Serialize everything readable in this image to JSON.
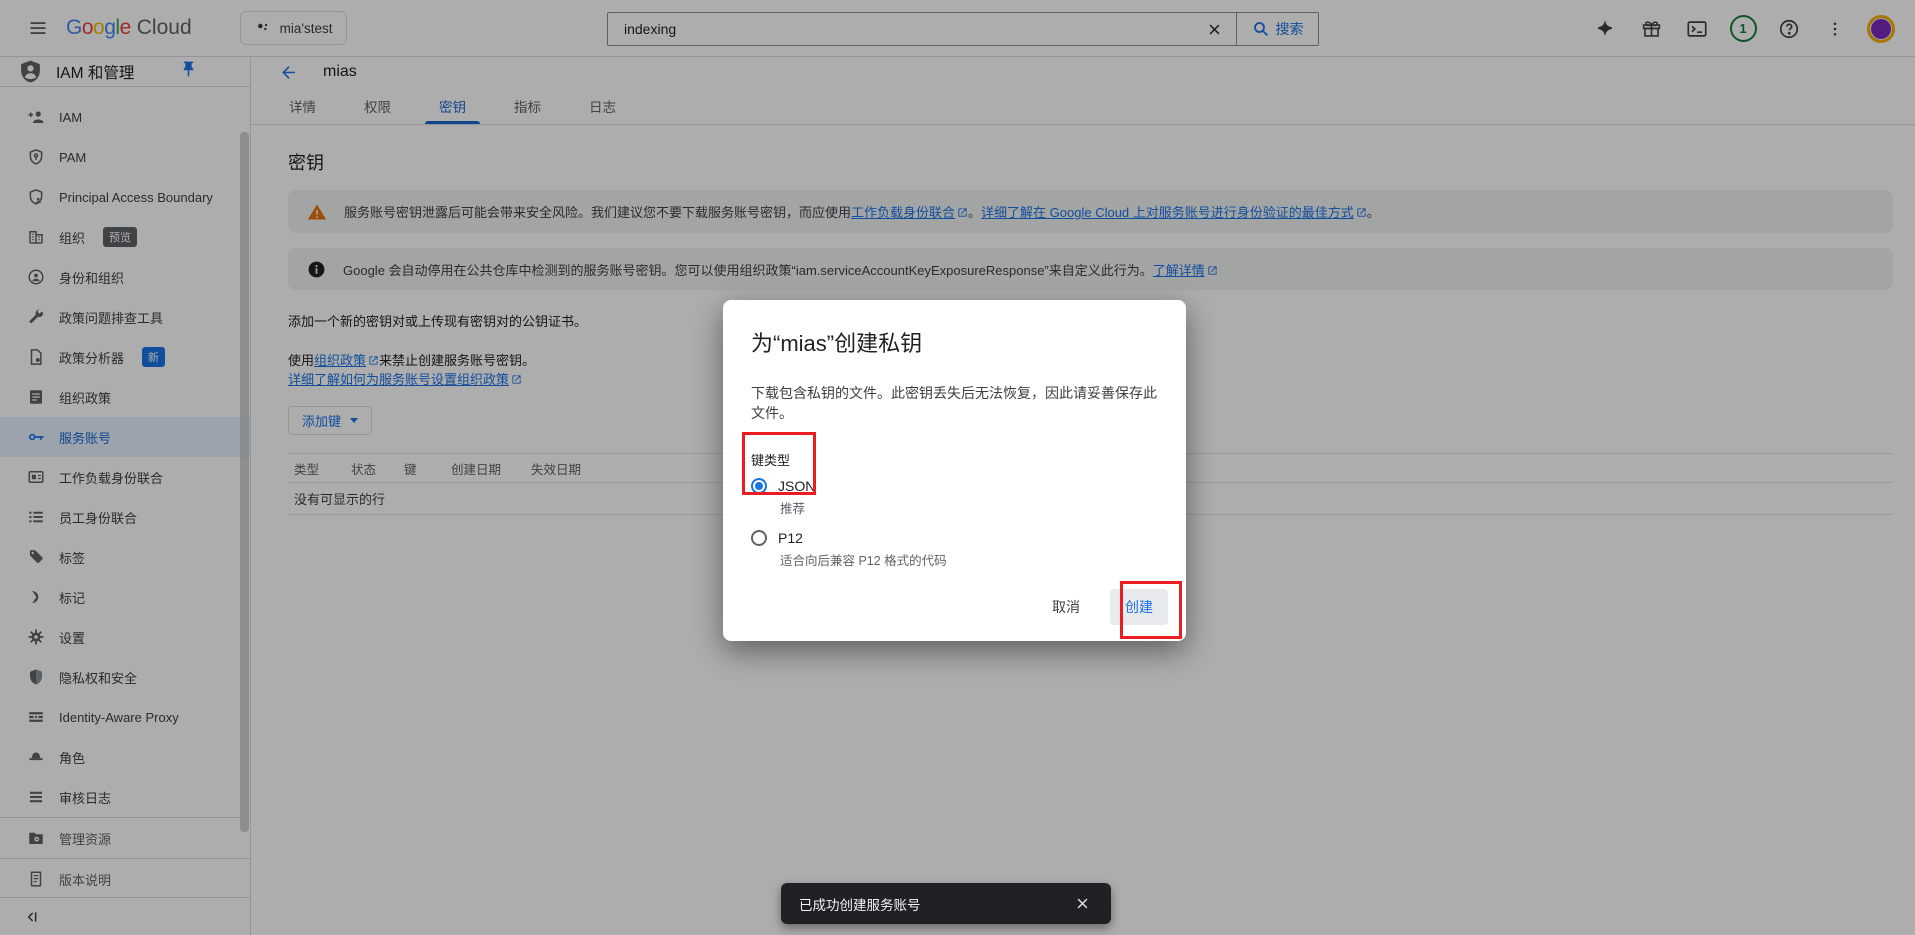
{
  "colors": {
    "accent_blue": "#1a73e8",
    "active_tab_blue": "#1967d2",
    "annotation_red": "#ea1d25",
    "warning_orange": "#e8710a",
    "selected_nav_bg": "#e8f0fe",
    "banner_bg": "#f1f3f4",
    "toast_bg": "#202124"
  },
  "topbar": {
    "logo": {
      "l0": "G",
      "l1": "o",
      "l2": "o",
      "l3": "g",
      "l4": "l",
      "l5": "e",
      "cloud": "Cloud"
    },
    "project_selector": {
      "label": "mia'stest"
    },
    "search": {
      "value": "indexing",
      "button_label": "搜索"
    },
    "notifications_count": "1"
  },
  "sidebar": {
    "header": {
      "title": "IAM 和管理"
    },
    "items": [
      {
        "label": "IAM"
      },
      {
        "label": "PAM"
      },
      {
        "label": "Principal Access Boundary"
      },
      {
        "label": "组织",
        "badge": "预览"
      },
      {
        "label": "身份和组织"
      },
      {
        "label": "政策问题排查工具"
      },
      {
        "label": "政策分析器",
        "badge": "新"
      },
      {
        "label": "组织政策"
      },
      {
        "label": "服务账号",
        "selected": true
      },
      {
        "label": "工作负载身份联合"
      },
      {
        "label": "员工身份联合"
      },
      {
        "label": "标签"
      },
      {
        "label": "标记"
      },
      {
        "label": "设置"
      },
      {
        "label": "隐私权和安全"
      },
      {
        "label": "Identity-Aware Proxy"
      },
      {
        "label": "角色"
      },
      {
        "label": "审核日志"
      },
      {
        "label": "管理资源"
      },
      {
        "label": "版本说明"
      }
    ]
  },
  "main": {
    "page_title": "mias",
    "tabs": [
      {
        "label": "详情",
        "active": false
      },
      {
        "label": "权限",
        "active": false
      },
      {
        "label": "密钥",
        "active": true
      },
      {
        "label": "指标",
        "active": false
      },
      {
        "label": "日志",
        "active": false
      }
    ],
    "heading": "密钥",
    "warning_banner": {
      "seg1": "服务账号密钥泄露后可能会带来安全风险。我们建议您不要下载服务账号密钥，而应使用",
      "link1": "工作负载身份联合",
      "seg2": "。",
      "link2": "详细了解在 Google Cloud 上对服务账号进行身份验证的最佳方式",
      "seg3": "。"
    },
    "info_banner": {
      "seg1": "Google 会自动停用在公共仓库中检测到的服务账号密钥。您可以使用组织政策“iam.serviceAccountKeyExposureResponse”来自定义此行为。",
      "link1": "了解详情"
    },
    "intro": "添加一个新的密钥对或上传现有密钥对的公钥证书。",
    "policy_line": {
      "seg1": "使用",
      "link": "组织政策",
      "seg2": "来禁止创建服务账号密钥。"
    },
    "policy_link2": "详细了解如何为服务账号设置组织政策",
    "add_key_button": "添加键",
    "table": {
      "headers": [
        "类型",
        "状态",
        "键",
        "创建日期",
        "失效日期"
      ],
      "empty": "没有可显示的行"
    }
  },
  "modal": {
    "title": "为“mias”创建私钥",
    "description": "下载包含私钥的文件。此密钥丢失后无法恢复，因此请妥善保存此文件。",
    "key_type_label": "键类型",
    "options": [
      {
        "label": "JSON",
        "sublabel": "推荐",
        "selected": true
      },
      {
        "label": "P12",
        "sublabel": "适合向后兼容 P12 格式的代码",
        "selected": false
      }
    ],
    "cancel_button": "取消",
    "create_button": "创建"
  },
  "toast": {
    "message": "已成功创建服务账号"
  }
}
